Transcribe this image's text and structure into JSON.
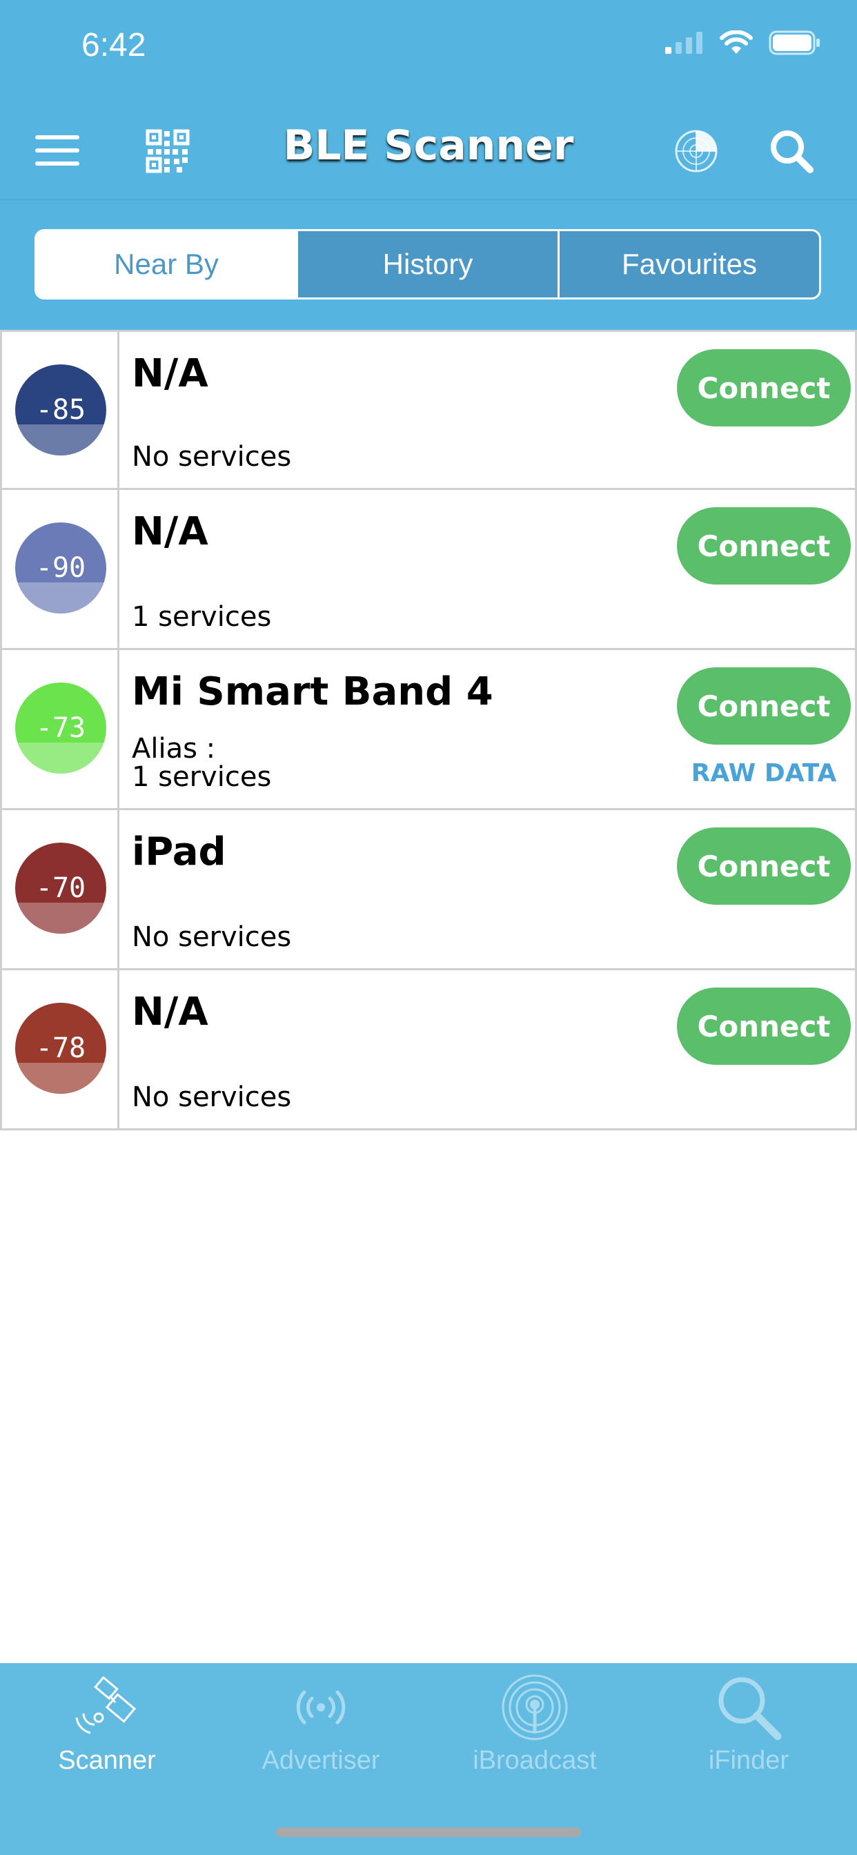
{
  "status_bar": {
    "time": "6:42"
  },
  "header": {
    "title": "BLE Scanner"
  },
  "segments": [
    {
      "label": "Near By",
      "active": true
    },
    {
      "label": "History",
      "active": false
    },
    {
      "label": "Favourites",
      "active": false
    }
  ],
  "devices": [
    {
      "rssi": "-85",
      "name": "N/A",
      "alias": "",
      "services": "No services",
      "color": "#2a4482",
      "connect": "Connect",
      "raw": ""
    },
    {
      "rssi": "-90",
      "name": "N/A",
      "alias": "",
      "services": "1 services",
      "color": "#6b7bb7",
      "connect": "Connect",
      "raw": ""
    },
    {
      "rssi": "-73",
      "name": "Mi Smart Band 4",
      "alias": "Alias :",
      "services": "1 services",
      "color": "#6be34c",
      "connect": "Connect",
      "raw": "RAW DATA"
    },
    {
      "rssi": "-70",
      "name": "iPad",
      "alias": "",
      "services": "No services",
      "color": "#8c2f2f",
      "connect": "Connect",
      "raw": ""
    },
    {
      "rssi": "-78",
      "name": "N/A",
      "alias": "",
      "services": "No services",
      "color": "#9a3a2c",
      "connect": "Connect",
      "raw": ""
    }
  ],
  "tabs": [
    {
      "label": "Scanner",
      "icon": "satellite-icon",
      "active": true
    },
    {
      "label": "Advertiser",
      "icon": "broadcast-icon",
      "active": false
    },
    {
      "label": "iBroadcast",
      "icon": "beacon-icon",
      "active": false
    },
    {
      "label": "iFinder",
      "icon": "magnifier-icon",
      "active": false
    }
  ],
  "colors": {
    "header": "#55b5e0",
    "segment": "#4b98c7",
    "connect": "#5bbe6a",
    "raw_data": "#4aa3d6",
    "tabbar": "#62bbe0"
  }
}
